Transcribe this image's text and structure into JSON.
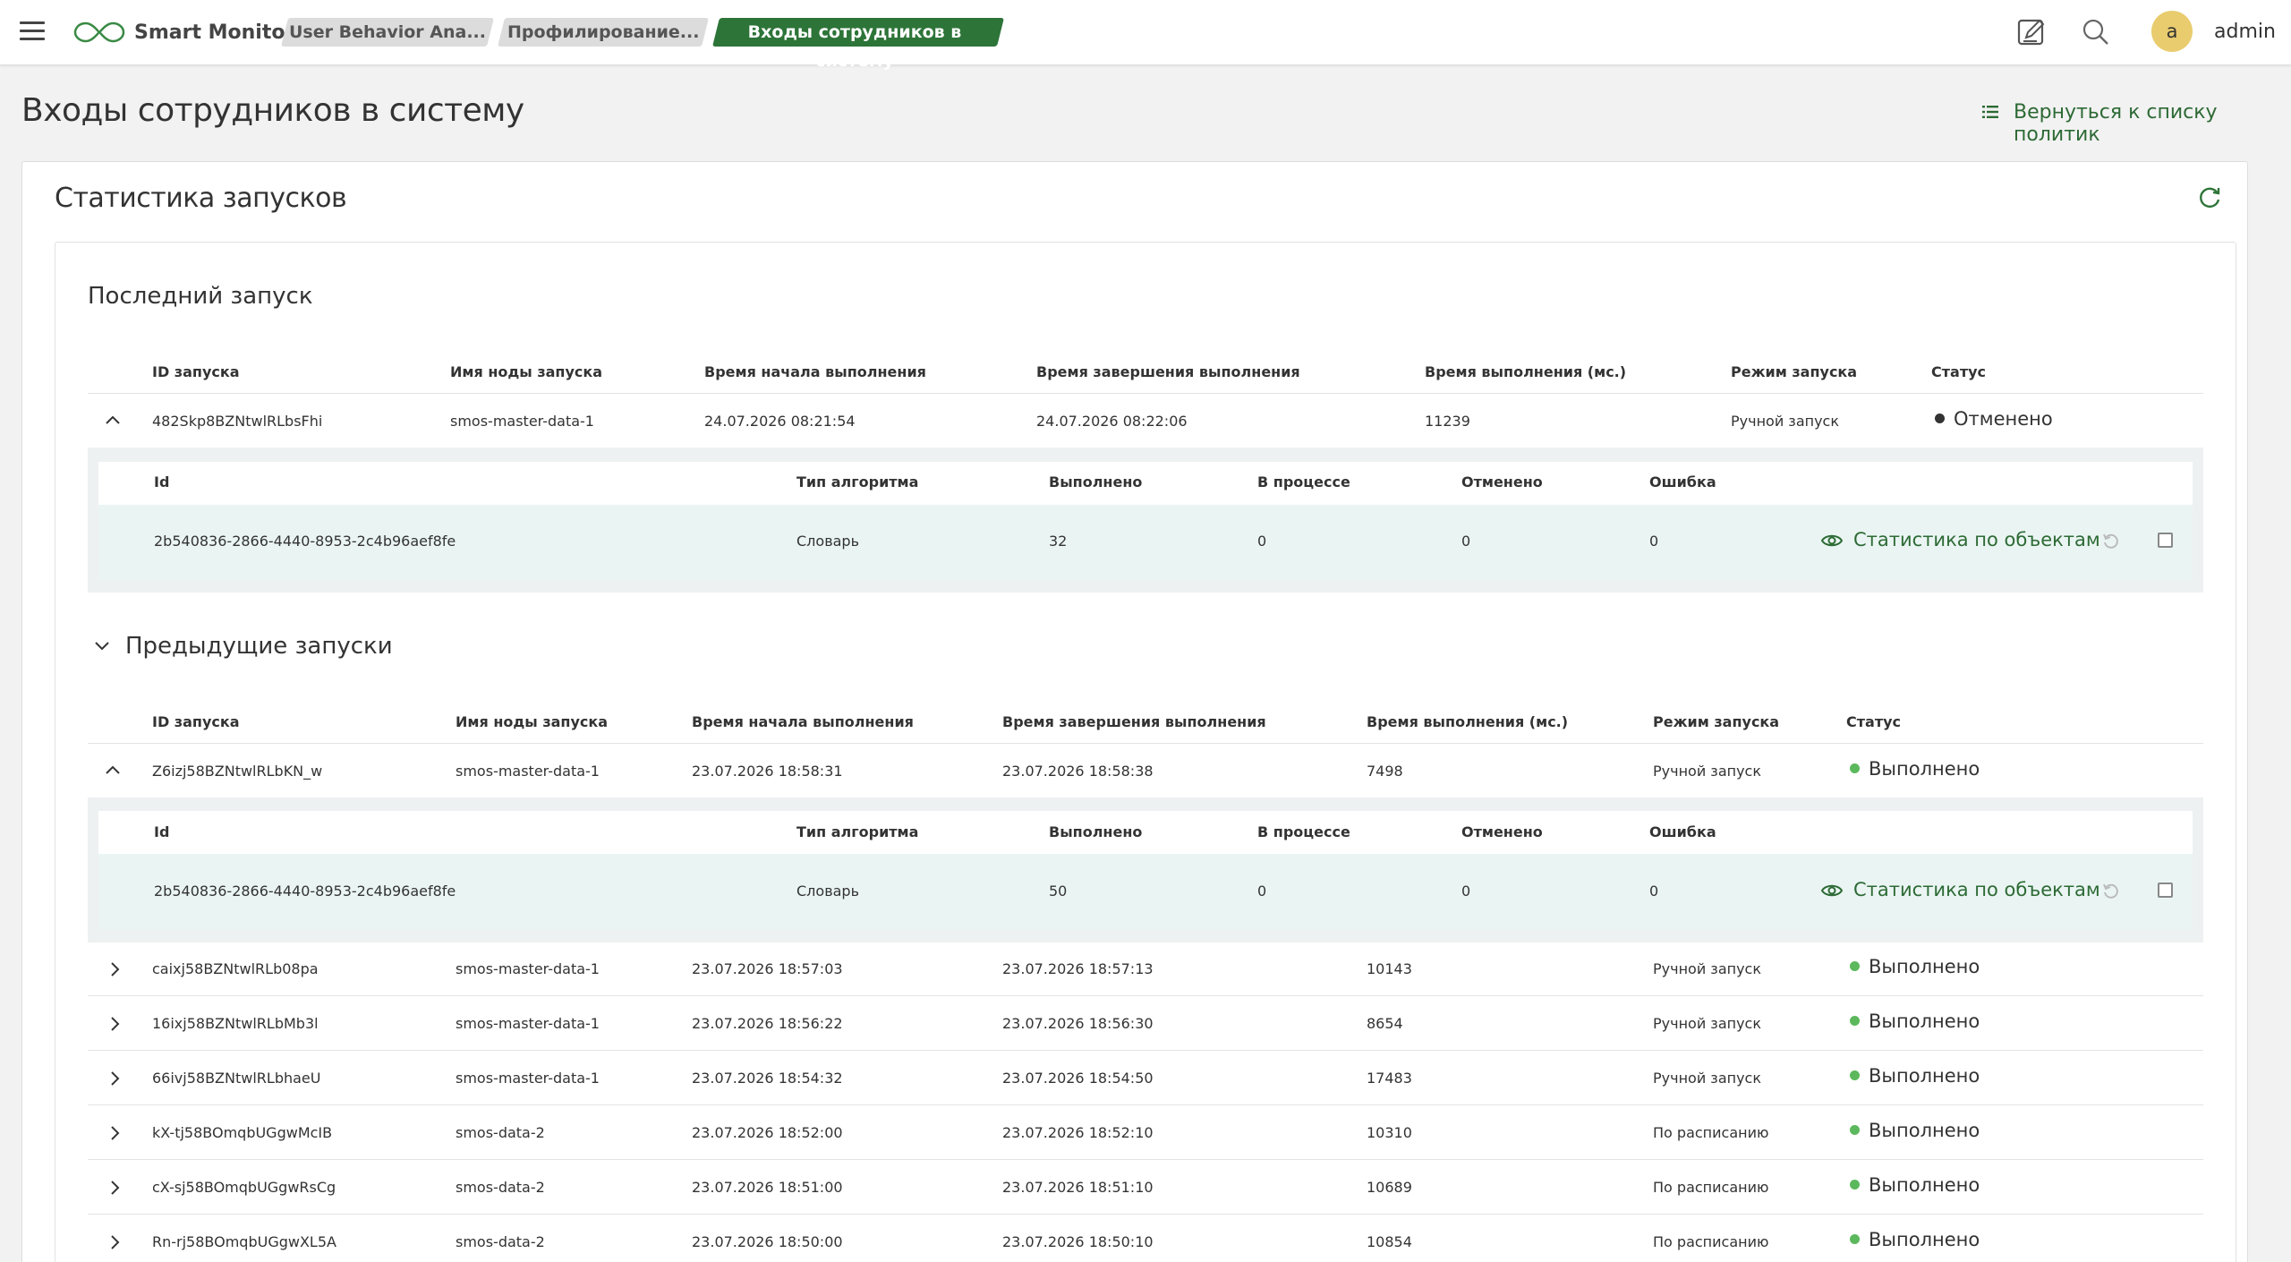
{
  "header": {
    "app_title": "Smart Monitor",
    "breadcrumbs": [
      "User Behavior Ana...",
      "Профилирование...",
      "Входы сотрудников в систему"
    ],
    "user_initial": "a",
    "user_name": "admin"
  },
  "page": {
    "title": "Входы сотрудников в систему",
    "back_link": "Вернуться к списку политик"
  },
  "card": {
    "title": "Статистика запусков"
  },
  "columns": {
    "run_id": "ID запуска",
    "node": "Имя ноды запуска",
    "start": "Время начала выполнения",
    "end": "Время завершения выполнения",
    "duration": "Время выполнения (мс.)",
    "mode": "Режим запуска",
    "status": "Статус"
  },
  "sub_columns": {
    "id": "Id",
    "algo": "Тип алгоритма",
    "done": "Выполнено",
    "in_progress": "В процессе",
    "cancelled": "Отменено",
    "error": "Ошибка"
  },
  "last_run": {
    "title": "Последний запуск",
    "row": {
      "id": "482Skp8BZNtwlRLbsFhi",
      "node": "smos-master-data-1",
      "start": "24.07.2026 08:21:54",
      "end": "24.07.2026 08:22:06",
      "duration": "11239",
      "mode": "Ручной запуск",
      "status": "Отменено",
      "status_color": "#333333"
    },
    "detail": {
      "id": "2b540836-2866-4440-8953-2c4b96aef8fe",
      "algo": "Словарь",
      "done": "32",
      "in_progress": "0",
      "cancelled": "0",
      "error": "0",
      "link": "Статистика по объектам"
    }
  },
  "previous": {
    "title": "Предыдущие запуски",
    "expanded_row": {
      "id": "Z6izj58BZNtwlRLbKN_w",
      "node": "smos-master-data-1",
      "start": "23.07.2026 18:58:31",
      "end": "23.07.2026 18:58:38",
      "duration": "7498",
      "mode": "Ручной запуск",
      "status": "Выполнено"
    },
    "detail": {
      "id": "2b540836-2866-4440-8953-2c4b96aef8fe",
      "algo": "Словарь",
      "done": "50",
      "in_progress": "0",
      "cancelled": "0",
      "error": "0",
      "link": "Статистика по объектам"
    },
    "rows": [
      {
        "id": "caixj58BZNtwlRLb08pa",
        "node": "smos-master-data-1",
        "start": "23.07.2026 18:57:03",
        "end": "23.07.2026 18:57:13",
        "duration": "10143",
        "mode": "Ручной запуск",
        "status": "Выполнено"
      },
      {
        "id": "16ixj58BZNtwlRLbMb3l",
        "node": "smos-master-data-1",
        "start": "23.07.2026 18:56:22",
        "end": "23.07.2026 18:56:30",
        "duration": "8654",
        "mode": "Ручной запуск",
        "status": "Выполнено"
      },
      {
        "id": "66ivj58BZNtwlRLbhaeU",
        "node": "smos-master-data-1",
        "start": "23.07.2026 18:54:32",
        "end": "23.07.2026 18:54:50",
        "duration": "17483",
        "mode": "Ручной запуск",
        "status": "Выполнено"
      },
      {
        "id": "kX-tj58BOmqbUGgwMcIB",
        "node": "smos-data-2",
        "start": "23.07.2026 18:52:00",
        "end": "23.07.2026 18:52:10",
        "duration": "10310",
        "mode": "По расписанию",
        "status": "Выполнено"
      },
      {
        "id": "cX-sj58BOmqbUGgwRsCg",
        "node": "smos-data-2",
        "start": "23.07.2026 18:51:00",
        "end": "23.07.2026 18:51:10",
        "duration": "10689",
        "mode": "По расписанию",
        "status": "Выполнено"
      },
      {
        "id": "Rn-rj58BOmqbUGgwXL5A",
        "node": "smos-data-2",
        "start": "23.07.2026 18:50:00",
        "end": "23.07.2026 18:50:10",
        "duration": "10854",
        "mode": "По расписанию",
        "status": "Выполнено"
      }
    ]
  },
  "colors": {
    "accent": "#2d7438",
    "success": "#5cb85c",
    "cancelled": "#333333"
  }
}
